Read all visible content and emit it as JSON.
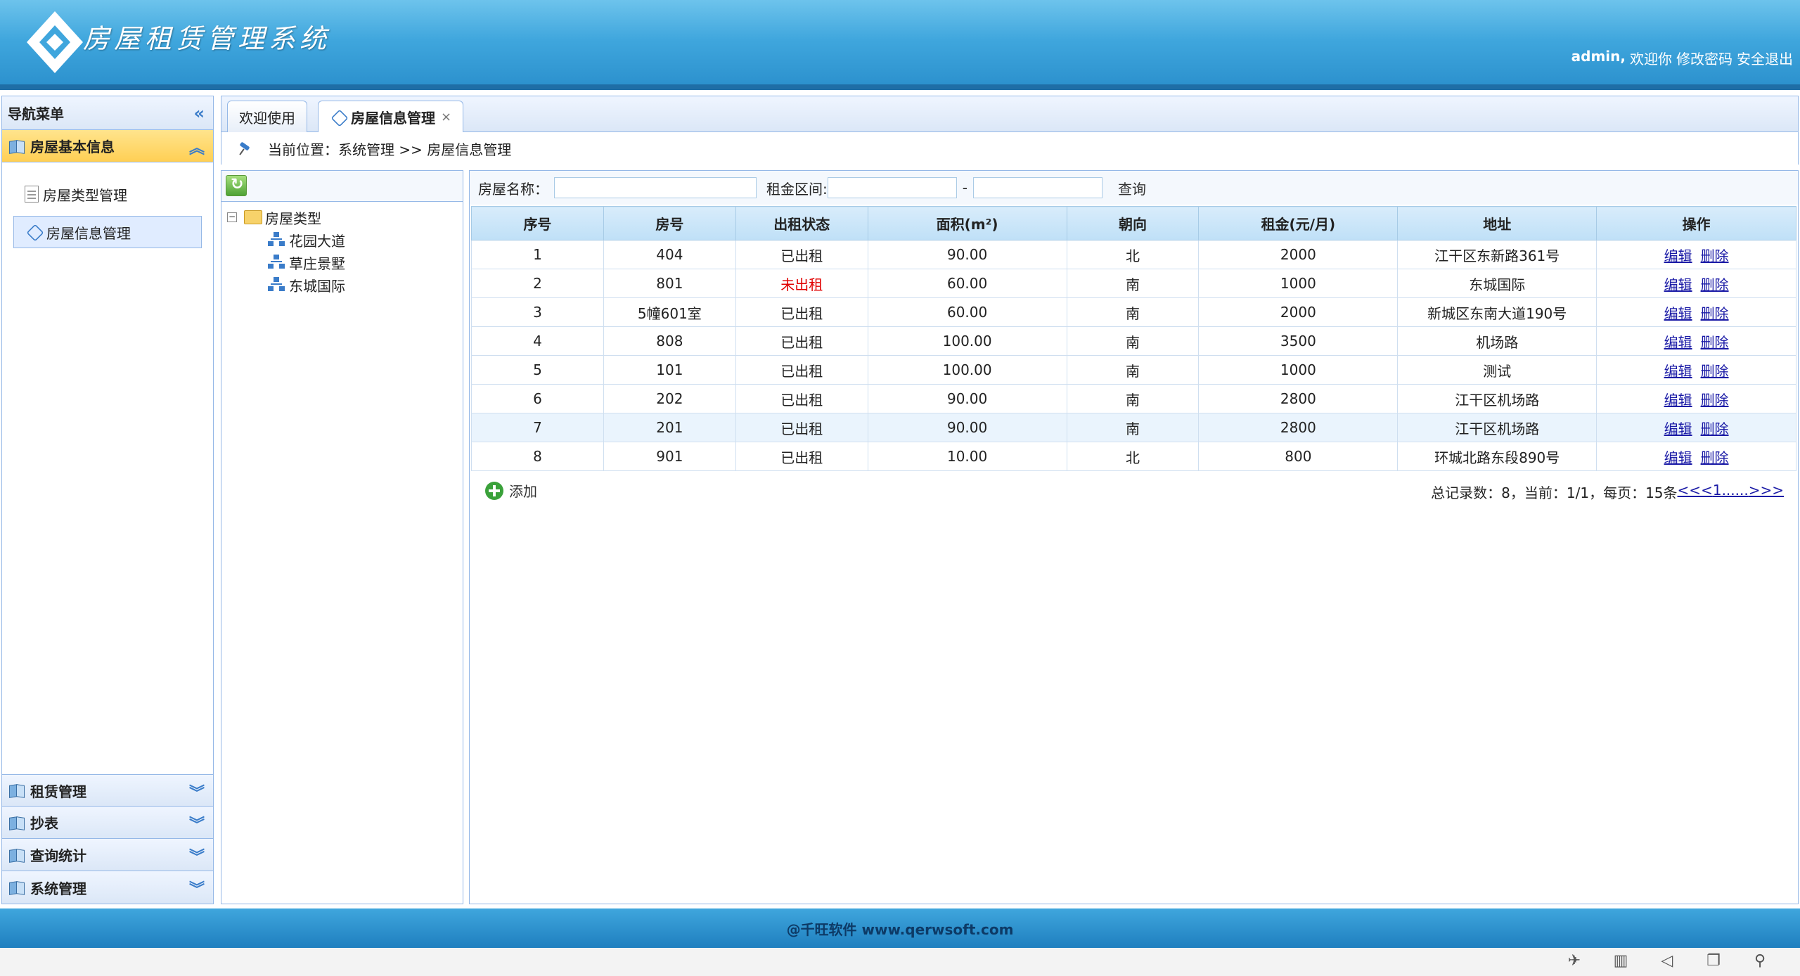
{
  "header": {
    "app_title": "房屋租赁管理系统",
    "username": "admin,",
    "welcome": "欢迎你",
    "change_password": "修改密码",
    "logout": "安全退出"
  },
  "nav": {
    "title": "导航菜单",
    "active_section": "房屋基本信息",
    "items": [
      "房屋类型管理",
      "房屋信息管理"
    ],
    "sections": [
      "租赁管理",
      "抄表",
      "查询统计",
      "系统管理"
    ]
  },
  "tabs": [
    "欢迎使用",
    "房屋信息管理"
  ],
  "breadcrumb": "当前位置：系统管理 >> 房屋信息管理",
  "tree": {
    "root": "房屋类型",
    "children": [
      "花园大道",
      "草庄景墅",
      "东城国际"
    ]
  },
  "search": {
    "name_label": "房屋名称：",
    "rent_label": "租金区间:",
    "separator": "-",
    "query_button": "查询"
  },
  "table": {
    "headers": [
      "序号",
      "房号",
      "出租状态",
      "面积(m²)",
      "朝向",
      "租金(元/月)",
      "地址",
      "操作"
    ],
    "rows": [
      [
        "1",
        "404",
        "已出租",
        "90.00",
        "北",
        "2000",
        "江干区东新路361号"
      ],
      [
        "2",
        "801",
        "未出租",
        "60.00",
        "南",
        "1000",
        "东城国际"
      ],
      [
        "3",
        "5幢601室",
        "已出租",
        "60.00",
        "南",
        "2000",
        "新城区东南大道190号"
      ],
      [
        "4",
        "808",
        "已出租",
        "100.00",
        "南",
        "3500",
        "机场路"
      ],
      [
        "5",
        "101",
        "已出租",
        "100.00",
        "南",
        "1000",
        "测试"
      ],
      [
        "6",
        "202",
        "已出租",
        "90.00",
        "南",
        "2800",
        "江干区机场路"
      ],
      [
        "7",
        "201",
        "已出租",
        "90.00",
        "南",
        "2800",
        "江干区机场路"
      ],
      [
        "8",
        "901",
        "已出租",
        "10.00",
        "北",
        "800",
        "环城北路东段890号"
      ]
    ],
    "edit_label": "编辑",
    "delete_label": "删除"
  },
  "footer_actions": {
    "add_label": "添加",
    "summary": "总记录数：8，当前：1/1，每页：15条",
    "pager_links": [
      "<<<",
      "1",
      "......",
      ">>>"
    ]
  },
  "footer": "@千旺软件 www.qerwsoft.com",
  "colors": {
    "header": "#3fa6dd",
    "unrented": "#e00000",
    "link": "#1a1aa6"
  }
}
